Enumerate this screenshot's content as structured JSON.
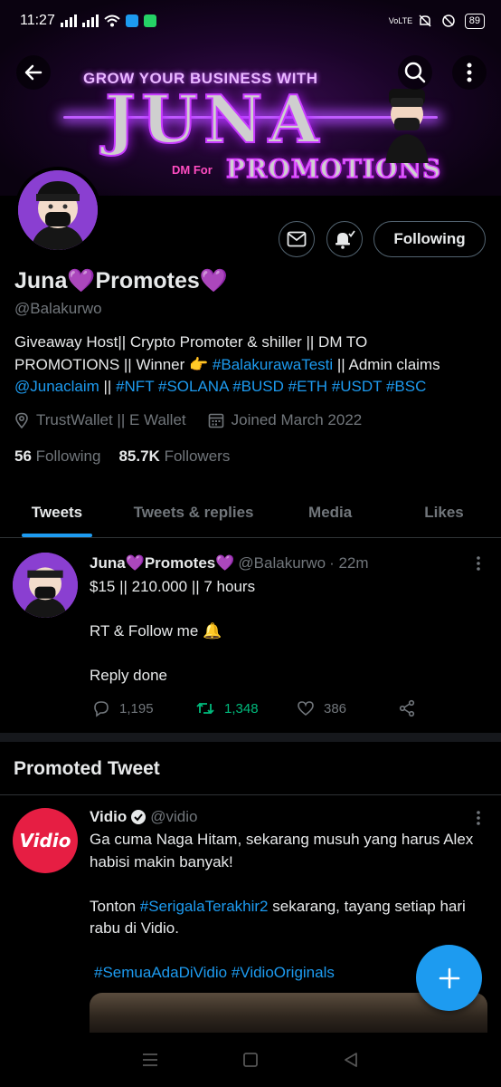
{
  "status_bar": {
    "time": "11:27",
    "battery": "89",
    "network_label": "VoLTE"
  },
  "banner": {
    "line1": "GROW YOUR BUSINESS WITH",
    "line2": "JUNA",
    "line3_prefix": "DM For",
    "line3": "PROMOTIONS"
  },
  "profile": {
    "name": "Juna💜Promotes💜",
    "handle": "@Balakurwo",
    "bio_line1": "Giveaway Host|| Crypto Promoter & shiller || DM TO",
    "bio_line2_a": "PROMOTIONS || Winner 👉 ",
    "bio_link1": "#BalakurawaTesti",
    "bio_line2_b": " || Admin claims",
    "bio_link2": "@Junaclaim",
    "bio_sep": " || ",
    "bio_tags": "#NFT #SOLANA #BUSD #ETH #USDT #BSC",
    "location": "TrustWallet || E Wallet",
    "joined": "Joined March 2022",
    "following_count": "56",
    "following_label": "Following",
    "followers_count": "85.7K",
    "followers_label": "Followers",
    "follow_button": "Following"
  },
  "tabs": [
    {
      "label": "Tweets",
      "active": true
    },
    {
      "label": "Tweets & replies",
      "active": false
    },
    {
      "label": "Media",
      "active": false
    },
    {
      "label": "Likes",
      "active": false
    }
  ],
  "tweet1": {
    "name": "Juna💜Promotes💜",
    "handle": "@Balakurwo",
    "time": "· 22m",
    "line1": "$15 || 210.000 || 7 hours",
    "line2": "RT & Follow me 🔔",
    "line3": "Reply done",
    "replies": "1,195",
    "retweets": "1,348",
    "likes": "386"
  },
  "promoted": {
    "section_title": "Promoted Tweet",
    "name": "Vidio",
    "handle": "@vidio",
    "avatar_text": "Vidio",
    "text1": "Ga cuma Naga Hitam, sekarang musuh yang harus Alex habisi makin banyak!",
    "text2_a": "Tonton ",
    "text2_link": "#SerigalaTerakhir2",
    "text2_b": " sekarang, tayang setiap hari rabu di Vidio.",
    "tags": "#SemuaAdaDiVidio #VidioOriginals"
  },
  "colors": {
    "accent": "#1d9bf0",
    "retweet": "#00ba7c",
    "muted": "#71767b",
    "vidio_red": "#e61e43"
  }
}
